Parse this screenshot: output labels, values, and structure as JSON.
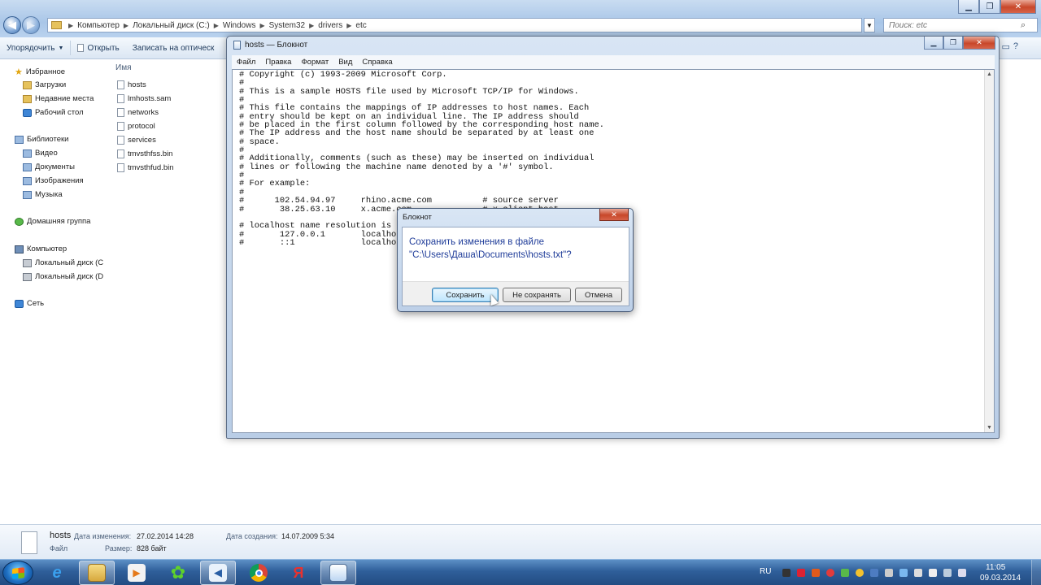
{
  "explorer": {
    "breadcrumb": [
      "Компьютер",
      "Локальный диск (C:)",
      "Windows",
      "System32",
      "drivers",
      "etc"
    ],
    "search_placeholder": "Поиск: etc",
    "toolbar": {
      "organize": "Упорядочить",
      "open": "Открыть",
      "burn": "Записать на оптическ"
    },
    "nav": {
      "favorites": "Избранное",
      "downloads": "Загрузки",
      "recent": "Недавние места",
      "desktop": "Рабочий стол",
      "libraries": "Библиотеки",
      "video": "Видео",
      "documents": "Документы",
      "pictures": "Изображения",
      "music": "Музыка",
      "homegroup": "Домашняя группа",
      "computer": "Компьютер",
      "disk_c": "Локальный диск (C",
      "disk_d": "Локальный диск (D",
      "network": "Сеть"
    },
    "column_name": "Имя",
    "files": [
      "hosts",
      "lmhosts.sam",
      "networks",
      "protocol",
      "services",
      "tmvsthfss.bin",
      "tmvsthfud.bin"
    ],
    "details": {
      "name": "hosts",
      "type": "Файл",
      "modified_label": "Дата изменения:",
      "modified_value": "27.02.2014 14:28",
      "created_label": "Дата создания:",
      "created_value": "14.07.2009 5:34",
      "size_label": "Размер:",
      "size_value": "828 байт"
    }
  },
  "notepad": {
    "title": "hosts — Блокнот",
    "menus": [
      "Файл",
      "Правка",
      "Формат",
      "Вид",
      "Справка"
    ],
    "content": "# Copyright (c) 1993-2009 Microsoft Corp.\n#\n# This is a sample HOSTS file used by Microsoft TCP/IP for Windows.\n#\n# This file contains the mappings of IP addresses to host names. Each\n# entry should be kept on an individual line. The IP address should\n# be placed in the first column followed by the corresponding host name.\n# The IP address and the host name should be separated by at least one\n# space.\n#\n# Additionally, comments (such as these) may be inserted on individual\n# lines or following the machine name denoted by a '#' symbol.\n#\n# For example:\n#\n#      102.54.94.97     rhino.acme.com          # source server\n#       38.25.63.10     x.acme.com              # x client host\n\n# localhost name resolution is handled within DNS itself.\n#       127.0.0.1       localhost\n#       ::1             localhost"
  },
  "dialog": {
    "title": "Блокнот",
    "message_line1": "Сохранить изменения в файле",
    "message_line2": "\"C:\\Users\\Даша\\Documents\\hosts.txt\"?",
    "save": "Сохранить",
    "dont_save": "Не сохранять",
    "cancel": "Отмена"
  },
  "taskbar": {
    "language": "RU",
    "time": "11:05",
    "date": "09.03.2014"
  },
  "colors": {
    "dialog_text": "#1f3c99",
    "taskbar": "#2f5f9a",
    "close_button": "#c8472a"
  }
}
